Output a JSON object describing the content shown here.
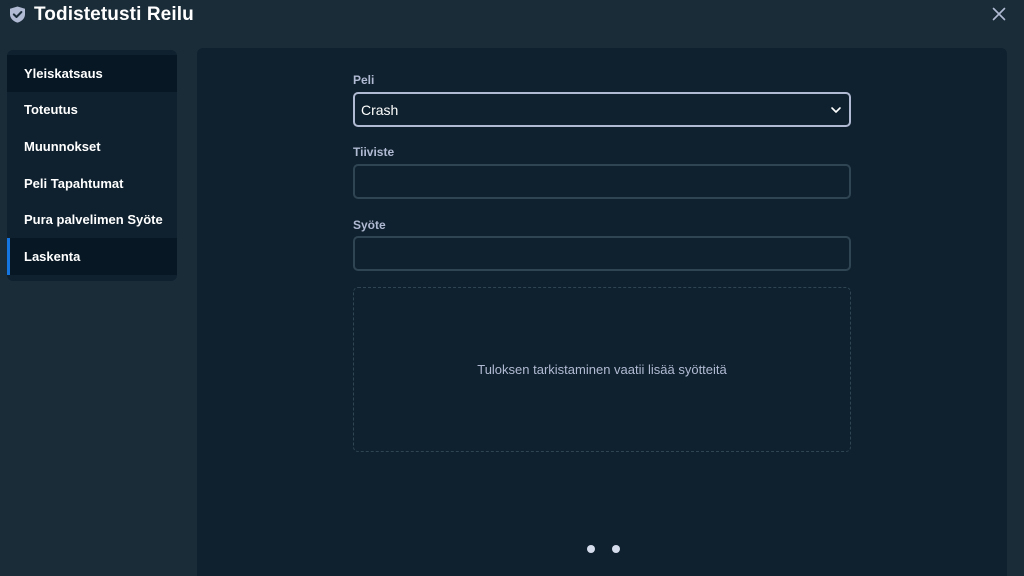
{
  "header": {
    "title": "Todistetusti Reilu",
    "logo_icon": "shield-check-icon",
    "close_icon": "close-icon"
  },
  "sidebar": {
    "items": [
      {
        "label": "Yleiskatsaus"
      },
      {
        "label": "Toteutus"
      },
      {
        "label": "Muunnokset"
      },
      {
        "label": "Peli Tapahtumat"
      },
      {
        "label": "Pura palvelimen Syöte"
      },
      {
        "label": "Laskenta"
      }
    ],
    "active_label": "Laskenta"
  },
  "form": {
    "game_label": "Peli",
    "game_value": "Crash",
    "hash_label": "Tiiviste",
    "hash_value": "",
    "seed_label": "Syöte",
    "seed_value": "",
    "result_message": "Tuloksen tarkistaminen vaatii lisää syötteitä"
  },
  "pagination": {
    "pages": 2
  },
  "colors": {
    "background": "#1a2c38",
    "panel": "#0f212e",
    "active_item": "#071824",
    "accent": "#1475e1",
    "label": "#b1bad3",
    "border": "#2f4553"
  }
}
